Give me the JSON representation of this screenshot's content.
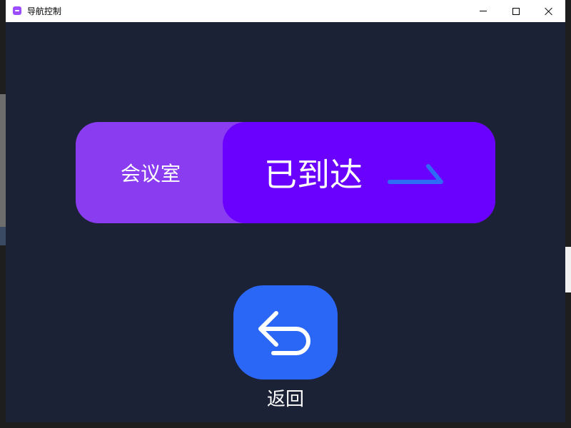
{
  "window": {
    "title": "导航控制"
  },
  "slider": {
    "destination_label": "会议室",
    "thumb_label": "已到达",
    "arrow_icon": "arrow-right-icon"
  },
  "back_button": {
    "icon": "return-arrow-icon",
    "label": "返回"
  },
  "colors": {
    "background": "#1b2236",
    "slider_track": "#8a3df0",
    "slider_thumb": "#6a00fd",
    "arrow": "#2f6cf6",
    "back_button": "#2a67f6",
    "text": "#ffffff"
  }
}
